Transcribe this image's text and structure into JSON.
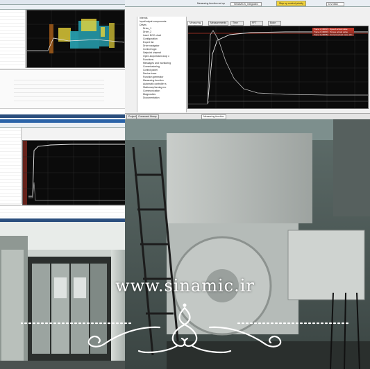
{
  "screenshot_top_right": {
    "toolbar_label": "Measuring function set up",
    "toolbar_item": "SINAMICS_Integrated",
    "button_label": "Stop up control priority",
    "combo_value": "Drv Main",
    "tabs": [
      "Measuring function",
      "Measurements",
      "Time diagram",
      "FFT diagram",
      "Bode diagram"
    ],
    "status_lines": [
      "Trace 1 (r0063) : Speed actual value",
      "Trace 2 (r0080) : Torque actual value",
      "Trace 3 (r0068) : Current actual value abs"
    ],
    "bottom_tabs": [
      "Project",
      "Command library"
    ],
    "bottom_tab_active": "Measuring function",
    "tree_items": [
      "Infeeds",
      "Input/output components",
      "Drives",
      "Drive_1",
      "Drive_2",
      "Insert DCC chart",
      "Configuration",
      "Expert list",
      "Drive navigator",
      "Control logic",
      "Setpoint channel",
      "Open-loop/closed-loop c",
      "Functions",
      "Messages and monitoring",
      "Commissioning",
      "Control panel",
      "Device trace",
      "Function generator",
      "Measuring function",
      "Automatic controller s",
      "Stationary/turning mo",
      "Communication",
      "Diagnostics",
      "Documentation"
    ]
  },
  "watermark": {
    "text": "www.sinamic.ir"
  },
  "colors": {
    "scope_bg": "#0b0b0b",
    "trace_white": "#e6e6e6",
    "trace_gray": "#9a9a9a",
    "trace_orange": "#e07b1c",
    "trace_yellow": "#e8d43a",
    "trace_cyan": "#2bb7c9",
    "taskbar": "#2b4f7e"
  }
}
